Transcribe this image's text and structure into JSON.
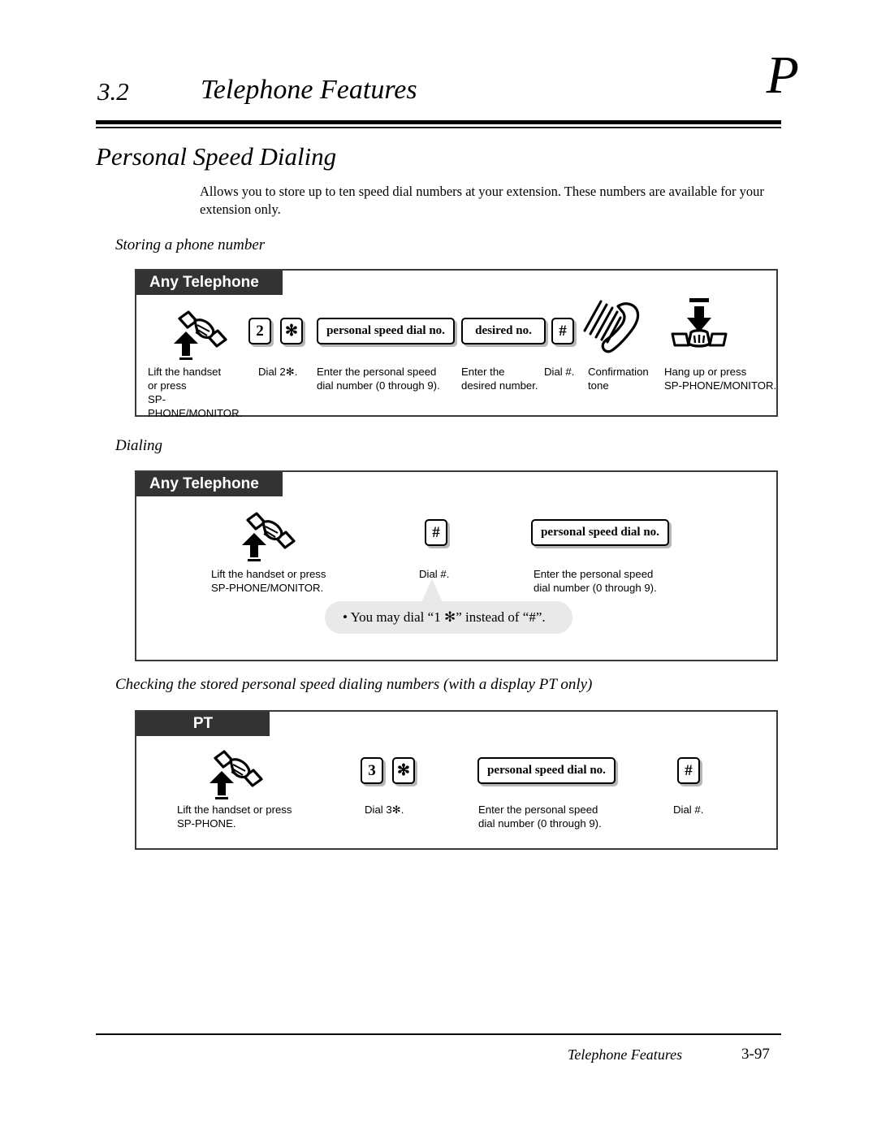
{
  "header": {
    "section_number": "3.2",
    "section_title": "Telephone Features",
    "thumb_letter": "P"
  },
  "feature": {
    "title": "Personal Speed Dialing",
    "description": "Allows you to store up to ten speed dial numbers at your extension. These numbers are available for your extension only."
  },
  "subheadings": {
    "storing": "Storing a phone number",
    "dialing": "Dialing",
    "checking": "Checking the stored personal speed dialing numbers (with a display PT only)"
  },
  "procedures": [
    {
      "id": "storing",
      "tab_label": "Any Telephone",
      "steps": [
        {
          "icon": "lift-handset-icon",
          "label": "Lift the handset\nor press\nSP-PHONE/MONITOR."
        },
        {
          "keys": [
            "2",
            "✻"
          ],
          "label": "Dial 2✻."
        },
        {
          "box": "personal speed dial no.",
          "label": "Enter the personal speed\ndial number (0 through 9)."
        },
        {
          "box": "desired no.",
          "label": "Enter the\ndesired number."
        },
        {
          "keys": [
            "#"
          ],
          "label": "Dial #."
        },
        {
          "icon": "confirmation-tone-icon",
          "label": "Confirmation\ntone"
        },
        {
          "icon": "hang-up-icon",
          "label": "Hang up or press\nSP-PHONE/MONITOR."
        }
      ]
    },
    {
      "id": "dialing",
      "tab_label": "Any Telephone",
      "steps": [
        {
          "icon": "lift-handset-icon",
          "label": "Lift the handset or press\nSP-PHONE/MONITOR."
        },
        {
          "keys": [
            "#"
          ],
          "label": "Dial #."
        },
        {
          "box": "personal speed dial no.",
          "label": "Enter the personal speed\ndial number (0 through 9)."
        }
      ],
      "note": "•  You may dial “1 ✻” instead of “#”."
    },
    {
      "id": "checking",
      "tab_label": "PT",
      "steps": [
        {
          "icon": "lift-handset-icon",
          "label": "Lift the handset or press\nSP-PHONE."
        },
        {
          "keys": [
            "3",
            "✻"
          ],
          "label": "Dial 3✻."
        },
        {
          "box": "personal speed dial no.",
          "label": "Enter the personal speed\ndial number (0 through 9)."
        },
        {
          "keys": [
            "#"
          ],
          "label": "Dial #."
        }
      ]
    }
  ],
  "footer": {
    "title": "Telephone Features",
    "page": "3-97"
  },
  "colors": {
    "tab_background": "#333333",
    "tab_text": "#ffffff",
    "box_border": "#3a3a3a",
    "callout_background": "#e9e9e9",
    "key_shadow": "#b7b7b7"
  }
}
